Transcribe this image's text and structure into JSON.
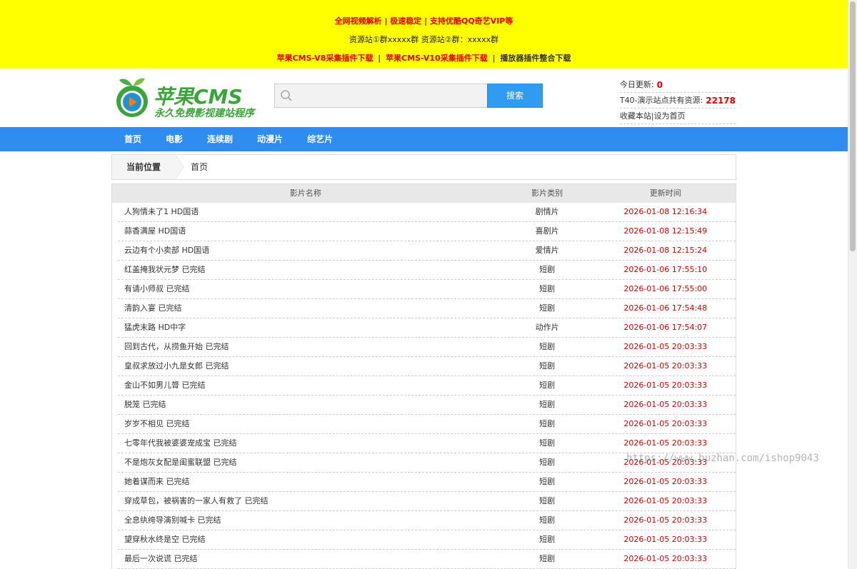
{
  "topbar": {
    "line1": "全网视频解析 | 极速稳定 | 支持优酷QQ奇艺VIP等",
    "line2": "资源站①群xxxxx群 资源站②群：xxxxx群",
    "line3_links": [
      "苹果CMS-V8采集插件下载",
      "苹果CMS-V10采集插件下载",
      "播放器插件整合下载"
    ],
    "separator": "|"
  },
  "logo": {
    "brand": "苹果CMS",
    "slogan": "永久免费影视建站程序"
  },
  "search": {
    "placeholder": "",
    "button": "搜索"
  },
  "stats": {
    "today_label": "今日更新:",
    "today_value": "0",
    "total_label": "T40-演示站点共有资源:",
    "total_value": "22178",
    "bookmark": "收藏本站",
    "divider": "|",
    "homepage": "设为首页"
  },
  "nav": {
    "items": [
      "首页",
      "电影",
      "连续剧",
      "动漫片",
      "综艺片"
    ]
  },
  "breadcrumb": {
    "label": "当前位置",
    "home": "首页"
  },
  "table": {
    "headers": [
      "影片名称",
      "影片类别",
      "更新时间"
    ],
    "rows": [
      [
        "人狗情未了1 HD国语",
        "剧情片",
        "2026-01-08 12:16:34"
      ],
      [
        "蒜香满屋 HD国语",
        "喜剧片",
        "2026-01-08 12:15:49"
      ],
      [
        "云边有个小卖部 HD国语",
        "爱情片",
        "2026-01-08 12:15:24"
      ],
      [
        "红盖掩我状元梦 已完结",
        "短剧",
        "2026-01-06 17:55:10"
      ],
      [
        "有请小师叔 已完结",
        "短剧",
        "2026-01-06 17:55:00"
      ],
      [
        "清韵入宴 已完结",
        "短剧",
        "2026-01-06 17:54:48"
      ],
      [
        "猛虎末路 HD中字",
        "动作片",
        "2026-01-06 17:54:07"
      ],
      [
        "回到古代，从捞鱼开始 已完结",
        "短剧",
        "2026-01-05 20:03:33"
      ],
      [
        "皇叔求放过小九是女郎 已完结",
        "短剧",
        "2026-01-05 20:03:33"
      ],
      [
        "金山不如男儿膂 已完结",
        "短剧",
        "2026-01-05 20:03:33"
      ],
      [
        "脱笼 已完结",
        "短剧",
        "2026-01-05 20:03:33"
      ],
      [
        "岁岁不相见 已完结",
        "短剧",
        "2026-01-05 20:03:33"
      ],
      [
        "七零年代我被婆婆宠成宝 已完结",
        "短剧",
        "2026-01-05 20:03:33"
      ],
      [
        "不是炮灰女配是闺蜜联盟 已完结",
        "短剧",
        "2026-01-05 20:03:33"
      ],
      [
        "她着谋而来 已完结",
        "短剧",
        "2026-01-05 20:03:33"
      ],
      [
        "穿成草包，被祸害的一家人有救了 已完结",
        "短剧",
        "2026-01-05 20:03:33"
      ],
      [
        "全息纨绔导演别喊卡 已完结",
        "短剧",
        "2026-01-05 20:03:33"
      ],
      [
        "望穿秋水终是空 已完结",
        "短剧",
        "2026-01-05 20:03:33"
      ],
      [
        "最后一次说谎 已完结",
        "短剧",
        "2026-01-05 20:03:33"
      ]
    ]
  },
  "watermark": "https://www.buzhan.com/ishop9043",
  "colors": {
    "topbar_bg": "#ffff00",
    "accent_red": "#e00000",
    "nav_blue": "#2f8cf0",
    "button_blue": "#2f9cf2",
    "brand_green": "#3aa539"
  }
}
